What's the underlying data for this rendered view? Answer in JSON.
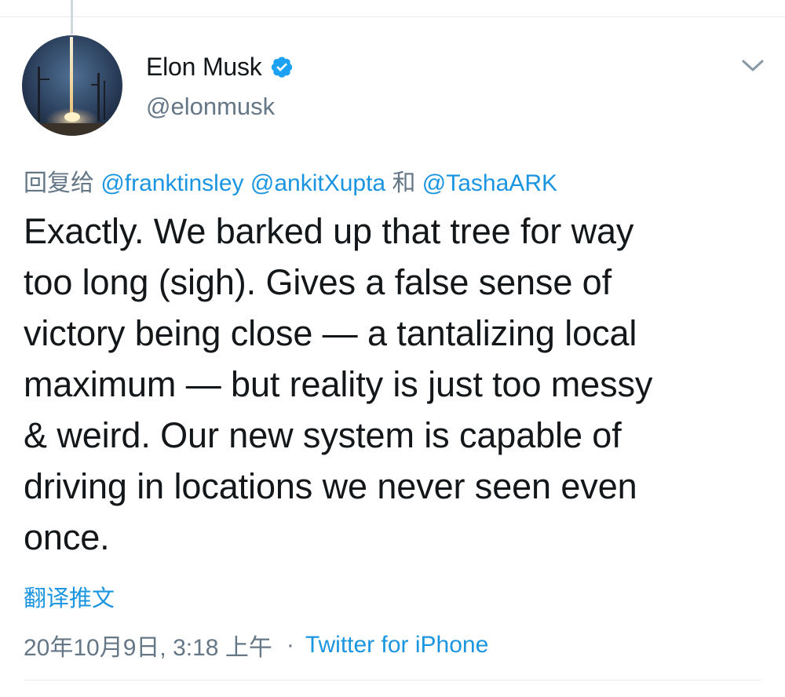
{
  "author": {
    "display_name": "Elon Musk",
    "handle": "@elonmusk",
    "verified": true
  },
  "reply": {
    "prefix": "回复给",
    "mentions": [
      "@franktinsley",
      "@ankitXupta"
    ],
    "conjunction": "和",
    "last_mention": "@TashaARK"
  },
  "tweet": {
    "text": "Exactly. We barked up that tree for way\ntoo long (sigh). Gives a false sense of\nvictory being close — a tantalizing local\nmaximum — but reality is just too messy\n& weird. Our new system is capable of\ndriving in locations we never seen even\nonce."
  },
  "translate_label": "翻译推文",
  "meta": {
    "timestamp": "20年10月9日, 3:18 上午",
    "separator": "·",
    "source": "Twitter for iPhone"
  },
  "colors": {
    "link": "#1b95e0",
    "secondary_text": "#657786",
    "verified_badge": "#1da1f2"
  },
  "icons": {
    "verified": "verified-badge-icon",
    "more": "chevron-down-icon"
  }
}
